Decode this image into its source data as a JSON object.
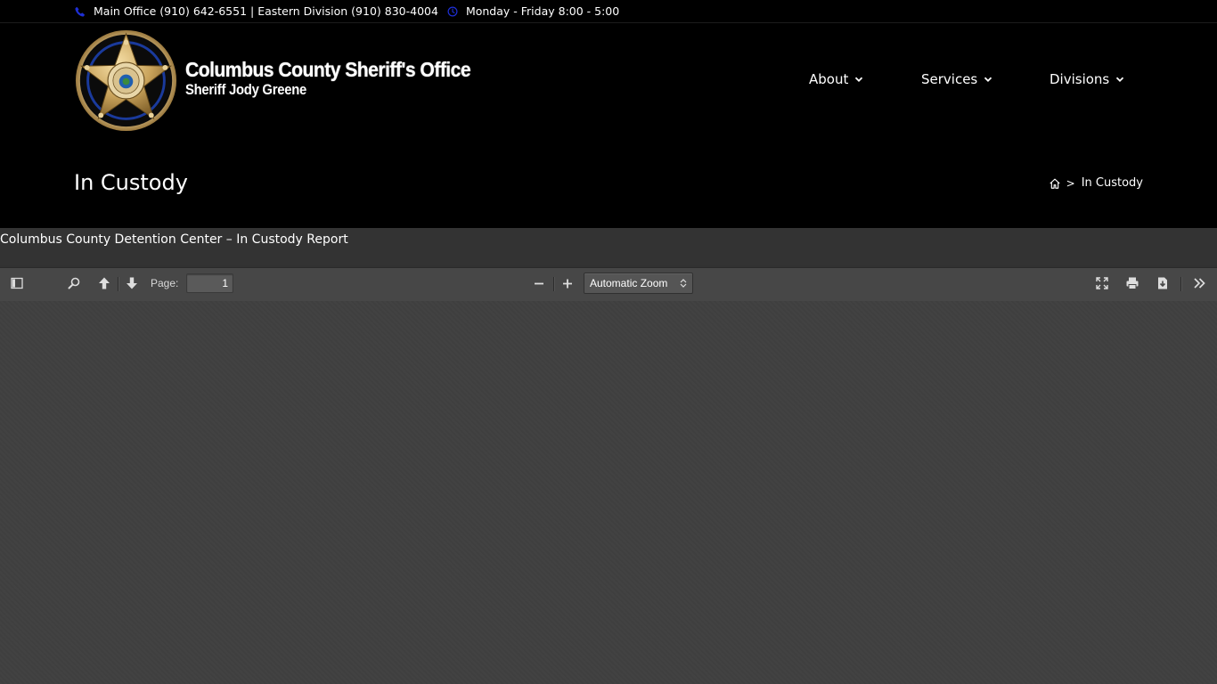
{
  "topbar": {
    "phone_text": "Main Office (910) 642-6551 | Eastern Division (910) 830-4004",
    "hours_text": "Monday - Friday 8:00 - 5:00",
    "phone_icon": "phone-icon",
    "clock_icon": "clock-icon",
    "icon_color": "#1e2fd6"
  },
  "header": {
    "logo": {
      "name": "sheriff-star-badge-logo",
      "ring_text": "COLUMBUS COUNTY",
      "center_text": "SHERIFF",
      "motto": "IN GOD WE TRUST"
    },
    "title": "Columbus County Sheriff's Office",
    "subtitle": "Sheriff Jody Greene"
  },
  "nav": {
    "items": [
      {
        "label": "About"
      },
      {
        "label": "Services"
      },
      {
        "label": "Divisions"
      }
    ]
  },
  "page": {
    "title": "In Custody",
    "breadcrumb": {
      "separator": ">",
      "current": "In Custody"
    }
  },
  "content": {
    "report_title": "Columbus County Detention Center – In Custody Report"
  },
  "pdf_viewer": {
    "page_label": "Page:",
    "page_number": "1",
    "zoom_value": "Automatic Zoom",
    "toolbar_bg": "#474747",
    "viewer_bg": "#404040"
  }
}
